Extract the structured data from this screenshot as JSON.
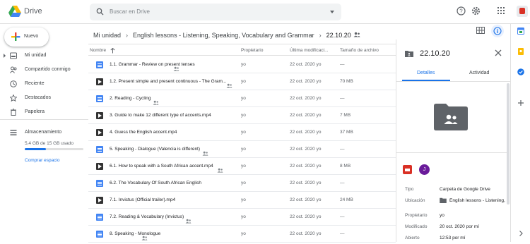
{
  "app": {
    "name": "Drive"
  },
  "search": {
    "placeholder": "Buscar en Drive"
  },
  "sidebar": {
    "new_label": "Nuevo",
    "items": [
      {
        "label": "Mi unidad",
        "icon": "my-drive-icon"
      },
      {
        "label": "Compartido conmigo",
        "icon": "shared-icon"
      },
      {
        "label": "Reciente",
        "icon": "clock-icon"
      },
      {
        "label": "Destacados",
        "icon": "star-icon"
      },
      {
        "label": "Papelera",
        "icon": "trash-icon"
      }
    ],
    "storage": {
      "label": "Almacenamiento",
      "used_text": "5,4 GB de 15 GB usado",
      "used_fraction": 0.36,
      "buy_label": "Comprar espacio"
    }
  },
  "breadcrumb": {
    "items": [
      "Mi unidad",
      "English lessons - Listening, Speaking, Vocabulary and Grammar",
      "22.10.20"
    ]
  },
  "table": {
    "headers": {
      "name": "Nombre",
      "owner": "Propietario",
      "modified": "Última modificaci...",
      "size": "Tamaño de archivo"
    },
    "rows": [
      {
        "name": "1.1. Grammar - Review on present tenses",
        "type": "doc",
        "owner": "yo",
        "modified": "22 oct. 2020 yo",
        "size": "—"
      },
      {
        "name": "1.2. Present simple and present continuous - The Gram...",
        "type": "video",
        "owner": "yo",
        "modified": "22 oct. 2020 yo",
        "size": "70 MB"
      },
      {
        "name": "2. Reading - Cycling",
        "type": "doc",
        "owner": "yo",
        "modified": "22 oct. 2020 yo",
        "size": "—"
      },
      {
        "name": "3. Guide to make 12 different type of accents.mp4",
        "type": "video",
        "owner": "yo",
        "modified": "22 oct. 2020 yo",
        "size": "7 MB"
      },
      {
        "name": "4. Guess the English accent.mp4",
        "type": "video",
        "owner": "yo",
        "modified": "22 oct. 2020 yo",
        "size": "37 MB"
      },
      {
        "name": "5. Speaking - Dialogue (Valencia is different)",
        "type": "doc",
        "owner": "yo",
        "modified": "22 oct. 2020 yo",
        "size": "—"
      },
      {
        "name": "6.1. How to speak with a South African accent.mp4",
        "type": "video",
        "owner": "yo",
        "modified": "22 oct. 2020 yo",
        "size": "8 MB"
      },
      {
        "name": "6.2. The Vocabulary Of South African English",
        "type": "doc",
        "owner": "yo",
        "modified": "22 oct. 2020 yo",
        "size": "—"
      },
      {
        "name": "7.1. Invictus (Official trailer).mp4",
        "type": "video",
        "owner": "yo",
        "modified": "22 oct. 2020 yo",
        "size": "24 MB"
      },
      {
        "name": "7.2. Reading & Vocabulary (Invictus)",
        "type": "doc",
        "owner": "yo",
        "modified": "22 oct. 2020 yo",
        "size": "—"
      },
      {
        "name": "8. Speaking - Monologue",
        "type": "doc",
        "owner": "yo",
        "modified": "22 oct. 2020 yo",
        "size": "—"
      }
    ]
  },
  "details": {
    "title": "22.10.20",
    "tabs": [
      "Detalles",
      "Actividad"
    ],
    "avatar_initial": "J",
    "props": [
      {
        "key": "Tipo",
        "value": "Carpeta de Google Drive"
      },
      {
        "key": "Ubicación",
        "value": "English lessons - Listening,"
      },
      {
        "key": "Propietario",
        "value": "yo"
      },
      {
        "key": "Modificado",
        "value": "20 oct. 2020 por mí"
      },
      {
        "key": "Abierto",
        "value": "12:53 por mí"
      }
    ]
  },
  "colors": {
    "accent": "#1a73e8",
    "doc": "#4285f4"
  }
}
